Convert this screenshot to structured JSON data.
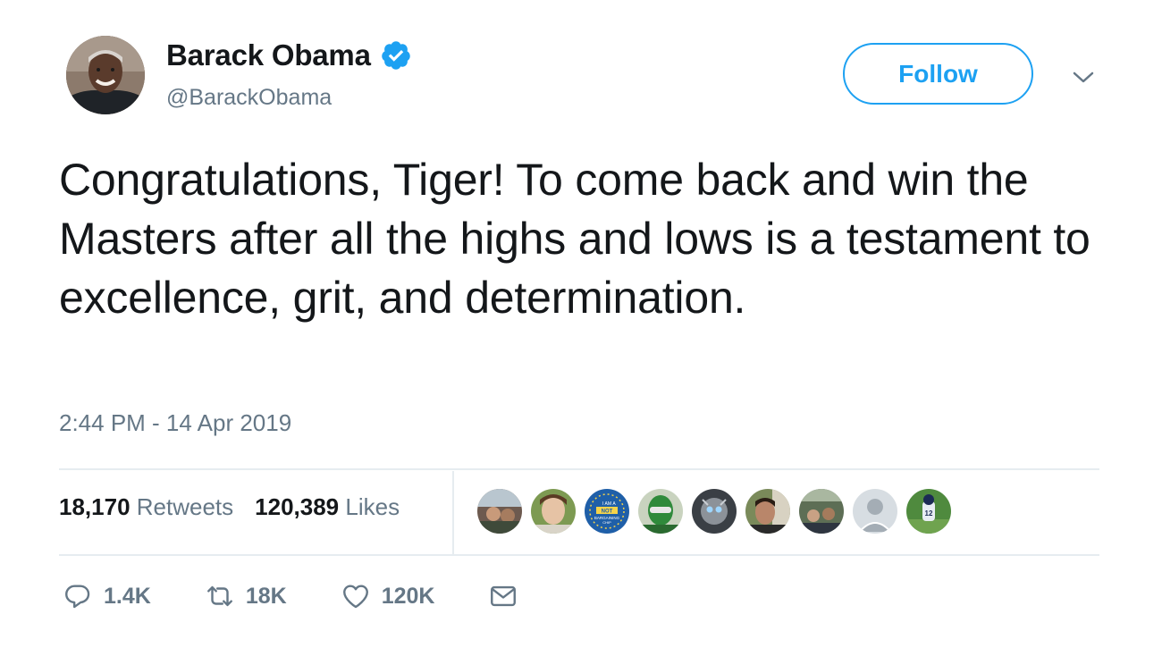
{
  "author": {
    "name": "Barack Obama",
    "handle": "@BarackObama",
    "verified": true
  },
  "follow_label": "Follow",
  "tweet": {
    "text": "Congratulations, Tiger! To come back and win the Masters after all the highs and lows is a testament to excellence, grit, and determination.",
    "timestamp": "2:44 PM - 14 Apr 2019"
  },
  "stats": {
    "retweets_count": "18,170",
    "retweets_label": "Retweets",
    "likes_count": "120,389",
    "likes_label": "Likes"
  },
  "likers_badge_text": [
    "I AM",
    "NOT",
    "A",
    "BARGAINING",
    "CHIP"
  ],
  "actions": {
    "reply_count": "1.4K",
    "retweet_count": "18K",
    "like_count": "120K"
  },
  "colors": {
    "accent": "#1da1f2",
    "text": "#14171a",
    "secondary": "#657786",
    "divider": "#e6ecf0"
  }
}
